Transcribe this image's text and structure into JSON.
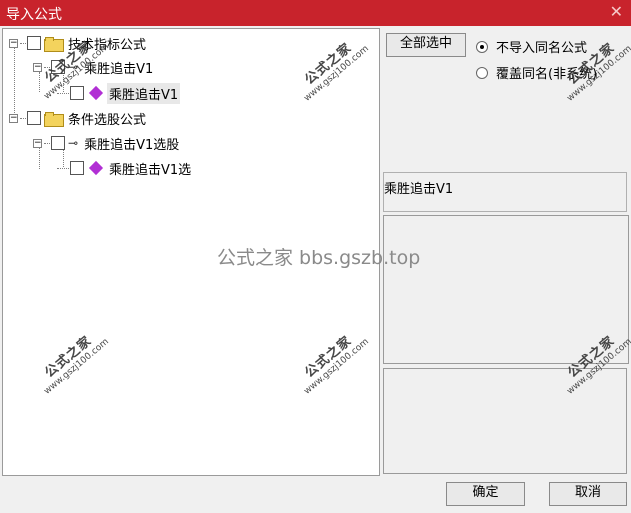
{
  "window": {
    "title": "导入公式",
    "close_glyph": "✕"
  },
  "tree": {
    "items": [
      {
        "label": "技术指标公式",
        "expander": "−"
      },
      {
        "label": "乘胜追击V1",
        "expander": "−"
      },
      {
        "label": "乘胜追击V1"
      },
      {
        "label": "条件选股公式",
        "expander": "−"
      },
      {
        "label": "乘胜追击V1选股",
        "expander": "−"
      },
      {
        "label": "乘胜追击V1选"
      }
    ]
  },
  "options": {
    "select_all_label": "全部选中",
    "radio_skip_label": "不导入同名公式",
    "radio_overwrite_label": "覆盖同名(非系统)",
    "selected_radio": "radio_skip_label"
  },
  "formula_name": "乘胜追击V1",
  "footer": {
    "ok_label": "确定",
    "cancel_label": "取消"
  },
  "watermark": {
    "stamp_text": "公式之家",
    "stamp_url": "www.gszj100.com",
    "center_text": "公式之家 bbs.gszb.top"
  }
}
